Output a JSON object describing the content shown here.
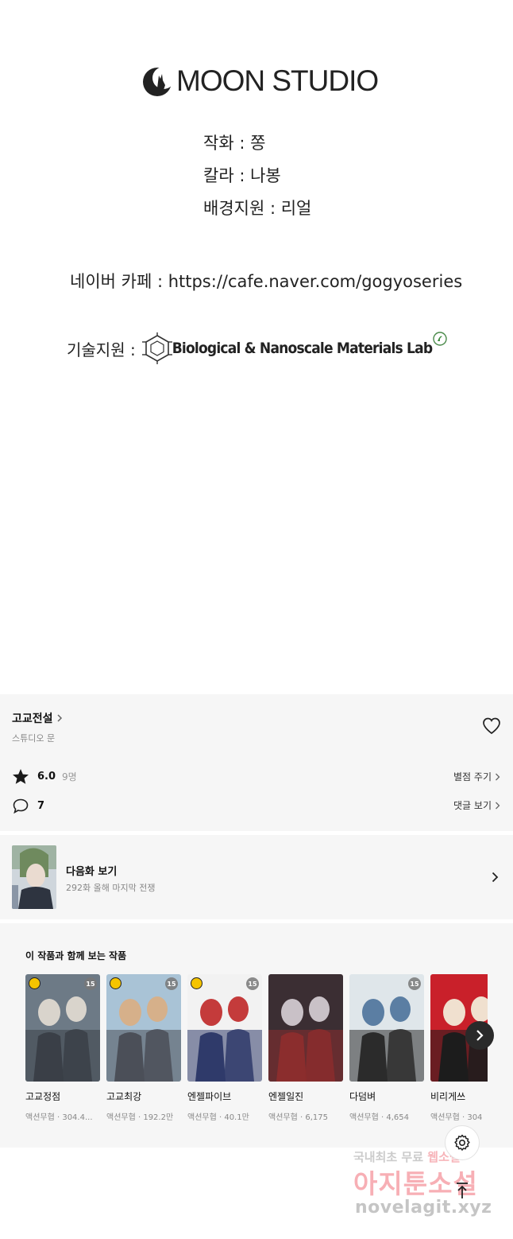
{
  "credits": {
    "logo_text": "MOON STUDIO",
    "lines": [
      "작화 : 쫑",
      "칼라 : 나봉",
      "배경지원 : 리얼"
    ],
    "cafe": "네이버 카페 : https://cafe.naver.com/gogyoseries",
    "tech_label": "기술지원 :",
    "lab_name": "Biological & Nanoscale Materials Lab"
  },
  "series": {
    "title": "고교전설",
    "author": "스튜디오 문",
    "rating": "6.0",
    "rating_count": "9명",
    "rate_label": "별점 주기",
    "comment_count": "7",
    "comment_label": "댓글 보기"
  },
  "next_episode": {
    "title": "다음화 보기",
    "subtitle": "292화 올해 마지막 전쟁"
  },
  "recommendations": {
    "heading": "이 작품과 함께 보는 작품",
    "items": [
      {
        "name": "고교정점",
        "meta": "액션무협 · 304.4...",
        "badge_clock": true,
        "badge_15": "15",
        "palette": [
          "#6d7a86",
          "#d9d4cc",
          "#3a3f47"
        ]
      },
      {
        "name": "고교최강",
        "meta": "액션무협 · 192.2만",
        "badge_clock": true,
        "badge_15": "15",
        "palette": [
          "#a9c3d6",
          "#d6b08a",
          "#4b4f58"
        ]
      },
      {
        "name": "엔젤파이브",
        "meta": "액션무협 · 40.1만",
        "badge_clock": true,
        "badge_15": "15",
        "palette": [
          "#f2f2f2",
          "#c43b3b",
          "#2f3a6a"
        ]
      },
      {
        "name": "엔젤일진",
        "meta": "액션무협 · 6,175",
        "badge_clock": false,
        "badge_15": "",
        "palette": [
          "#3b2e33",
          "#c9c1c7",
          "#8b2d2d"
        ]
      },
      {
        "name": "다덤벼",
        "meta": "액션무협 · 4,654",
        "badge_clock": false,
        "badge_15": "15",
        "palette": [
          "#dfe6ea",
          "#5b7ea3",
          "#2b2b2b"
        ]
      },
      {
        "name": "비리게쓰",
        "meta": "액션무협 · 304",
        "badge_clock": false,
        "badge_15": "",
        "palette": [
          "#c9202a",
          "#f0e0cf",
          "#1c1c1c"
        ]
      }
    ]
  },
  "watermark": {
    "line1_a": "국내최초 무료",
    "line1_b": "웹소설",
    "line2": "아지툰소설",
    "line3": "novelagit.xyz"
  },
  "colors": {
    "panel_bg": "#f6f6f6",
    "text": "#111111",
    "muted": "#888888",
    "badge_yellow": "#f5c400"
  }
}
